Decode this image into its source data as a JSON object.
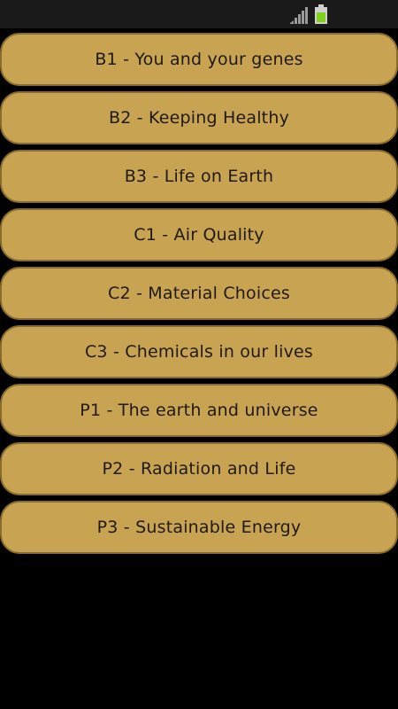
{
  "status_bar": {
    "signal_icon": "signal-strength-icon",
    "battery_icon": "battery-charging-icon",
    "battery_color": "#7fd21a"
  },
  "menu": {
    "items": [
      {
        "label": "B1  - You and your genes"
      },
      {
        "label": "B2  - Keeping Healthy"
      },
      {
        "label": "B3  - Life on Earth"
      },
      {
        "label": "C1  - Air Quality"
      },
      {
        "label": "C2  - Material Choices"
      },
      {
        "label": "C3  - Chemicals in our lives"
      },
      {
        "label": "P1  - The earth and universe"
      },
      {
        "label": "P2  - Radiation and Life"
      },
      {
        "label": "P3  - Sustainable Energy"
      }
    ]
  },
  "colors": {
    "button_fill": "#c8a352",
    "button_border": "#8a6d2b",
    "background": "#000000"
  }
}
